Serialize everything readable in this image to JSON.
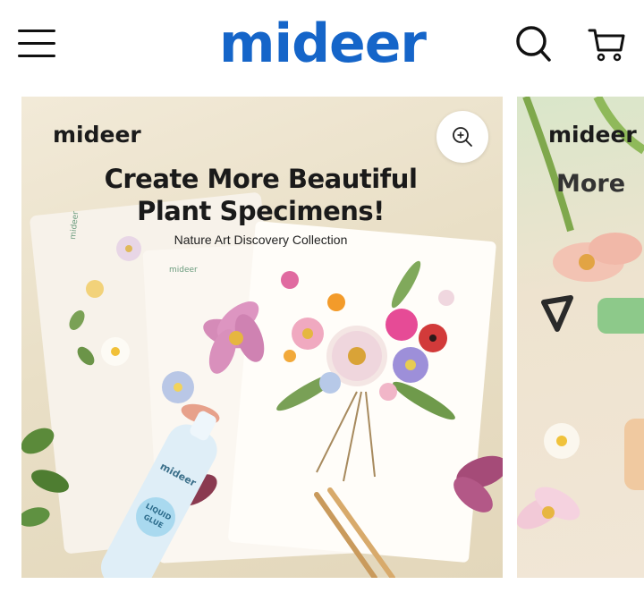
{
  "header": {
    "brand": "mideer",
    "menu_icon": "hamburger-menu-icon",
    "search_icon": "search-icon",
    "cart_icon": "cart-icon",
    "brand_color": "#1565c9"
  },
  "carousel": {
    "slides": [
      {
        "brand": "mideer",
        "headline_line1": "Create More Beautiful",
        "headline_line2": "Plant Specimens!",
        "subheadline": "Nature Art Discovery Collection",
        "card_brand": "mideer",
        "bottle_brand": "mideer",
        "bottle_label": "LIQUID GLUE",
        "zoom_icon": "zoom-in-icon"
      },
      {
        "brand": "mideer",
        "headline": "More"
      }
    ]
  }
}
